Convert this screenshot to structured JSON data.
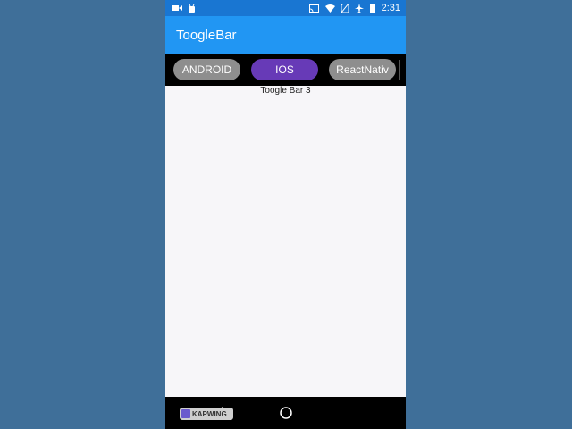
{
  "status_bar": {
    "time": "2:31",
    "left_icons": [
      "video-camera-icon",
      "android-icon"
    ],
    "right_icons": [
      "cast-icon",
      "wifi-icon",
      "no-sim-icon",
      "airplane-icon",
      "battery-icon"
    ]
  },
  "app_bar": {
    "title": "ToogleBar"
  },
  "toggle_bar": {
    "items": [
      {
        "label": "ANDROID",
        "selected": false
      },
      {
        "label": "IOS",
        "selected": true
      },
      {
        "label": "ReactNativ",
        "selected": false
      }
    ],
    "colors": {
      "selected": "#673ab7",
      "unselected": "#8e8e8e",
      "background": "#000000"
    }
  },
  "content": {
    "label": "Toogle Bar 3"
  },
  "nav_bar": {
    "buttons": [
      "back-icon",
      "home-icon"
    ]
  },
  "watermark": {
    "text": "KAPWING"
  },
  "colors": {
    "app_bar": "#2196f3",
    "status_bar": "#1976d2",
    "page_background": "#3f6f99"
  }
}
